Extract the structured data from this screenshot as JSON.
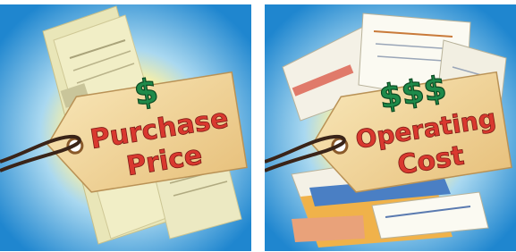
{
  "panels": [
    {
      "symbol": "$",
      "line1": "Purchase",
      "line2": "Price"
    },
    {
      "symbol": "$$$",
      "line1": "Operating",
      "line2": "Cost"
    }
  ],
  "colors": {
    "sky_blue": "#2b8fd4",
    "sun_yellow": "#fff6a8",
    "tag_tan": "#f3d9a0",
    "dollar_green": "#1e8a4a",
    "text_red": "#d9382f",
    "string_dark": "#3a2418"
  }
}
